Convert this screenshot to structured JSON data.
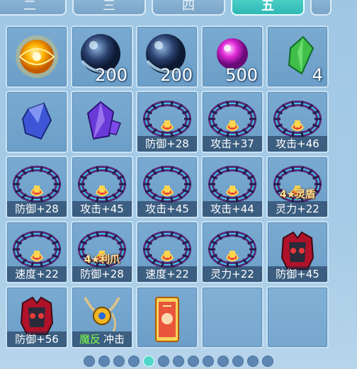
{
  "tabs": [
    {
      "label": "二",
      "active": false
    },
    {
      "label": "三",
      "active": false
    },
    {
      "label": "四",
      "active": false
    },
    {
      "label": "五",
      "active": true
    },
    {
      "label": "",
      "active": false
    }
  ],
  "items": [
    {
      "icon": "golden-orb-icon",
      "qty": ""
    },
    {
      "icon": "dark-crystal-ball-icon",
      "qty": "200"
    },
    {
      "icon": "dark-crystal-ball-icon",
      "qty": "200"
    },
    {
      "icon": "pink-pearl-icon",
      "qty": "500"
    },
    {
      "icon": "green-gem-icon",
      "qty": "4"
    },
    {
      "icon": "blue-crystal-icon",
      "qty": ""
    },
    {
      "icon": "purple-crystal-icon",
      "qty": ""
    },
    {
      "icon": "spiked-ring-icon",
      "stat": "防御+28"
    },
    {
      "icon": "spiked-ring-icon",
      "stat": "攻击+37"
    },
    {
      "icon": "spiked-ring-icon",
      "stat": "攻击+46"
    },
    {
      "icon": "spiked-ring-icon",
      "stat": "防御+28"
    },
    {
      "icon": "spiked-ring-icon",
      "stat": "攻击+45"
    },
    {
      "icon": "spiked-ring-icon",
      "stat": "攻击+45"
    },
    {
      "icon": "spiked-ring-icon",
      "stat": "攻击+44"
    },
    {
      "icon": "spiked-ring-icon",
      "stat": "灵力+22",
      "tag": "4★灵盾"
    },
    {
      "icon": "spiked-ring-icon",
      "stat": "速度+22"
    },
    {
      "icon": "spiked-ring-icon",
      "stat": "防御+28",
      "tag": "4★利爪"
    },
    {
      "icon": "spiked-ring-icon",
      "stat": "速度+22"
    },
    {
      "icon": "spiked-ring-icon",
      "stat": "灵力+22"
    },
    {
      "icon": "armor-vest-icon",
      "stat": "防御+45"
    },
    {
      "icon": "armor-vest-icon",
      "stat": "防御+56"
    },
    {
      "icon": "amulet-necklace-icon",
      "stat": "冲击",
      "stat_prefix": "魔反"
    },
    {
      "icon": "scroll-talisman-icon",
      "stat": ""
    },
    {
      "icon": "",
      "stat": ""
    },
    {
      "icon": "",
      "stat": ""
    }
  ],
  "pager": {
    "count": 13,
    "active_index": 4
  },
  "colors": {
    "active_tab": "#2fb7b5",
    "stat_green": "#7fff4a",
    "tag_gold": "#ffe3a0"
  }
}
